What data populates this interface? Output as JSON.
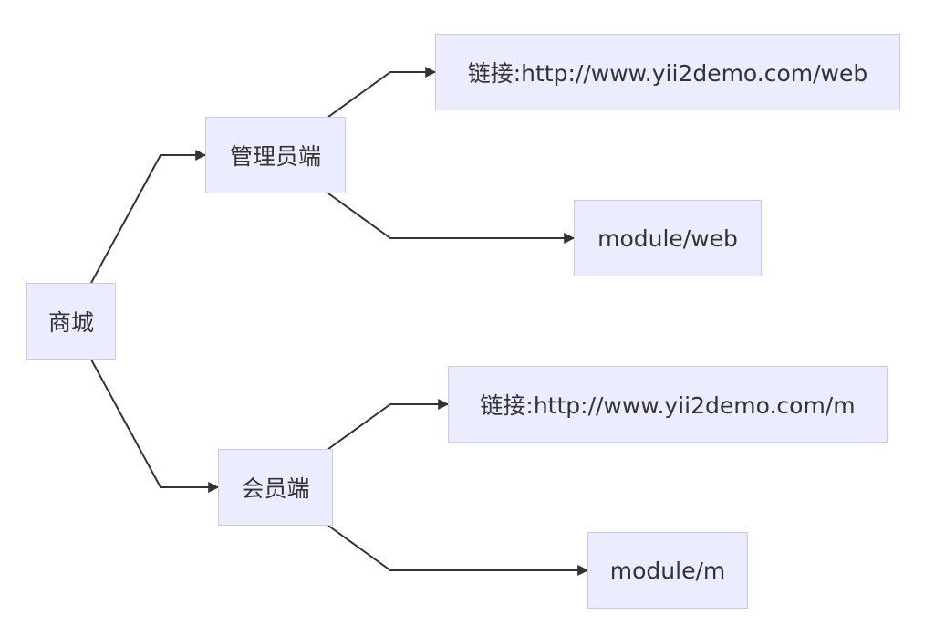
{
  "diagram": {
    "type": "flowchart",
    "direction": "left-to-right",
    "colors": {
      "node_fill": "#ececff",
      "node_border": "#c9c9f0",
      "edge": "#333333",
      "text": "#333333"
    },
    "nodes": {
      "root": {
        "label": "商城"
      },
      "admin": {
        "label": "管理员端"
      },
      "member": {
        "label": "会员端"
      },
      "admin_link": {
        "label": "链接:http://www.yii2demo.com/web"
      },
      "admin_module": {
        "label": "module/web"
      },
      "member_link": {
        "label": "链接:http://www.yii2demo.com/m"
      },
      "member_module": {
        "label": "module/m"
      }
    },
    "edges": [
      {
        "from": "root",
        "to": "admin"
      },
      {
        "from": "root",
        "to": "member"
      },
      {
        "from": "admin",
        "to": "admin_link"
      },
      {
        "from": "admin",
        "to": "admin_module"
      },
      {
        "from": "member",
        "to": "member_link"
      },
      {
        "from": "member",
        "to": "member_module"
      }
    ]
  }
}
